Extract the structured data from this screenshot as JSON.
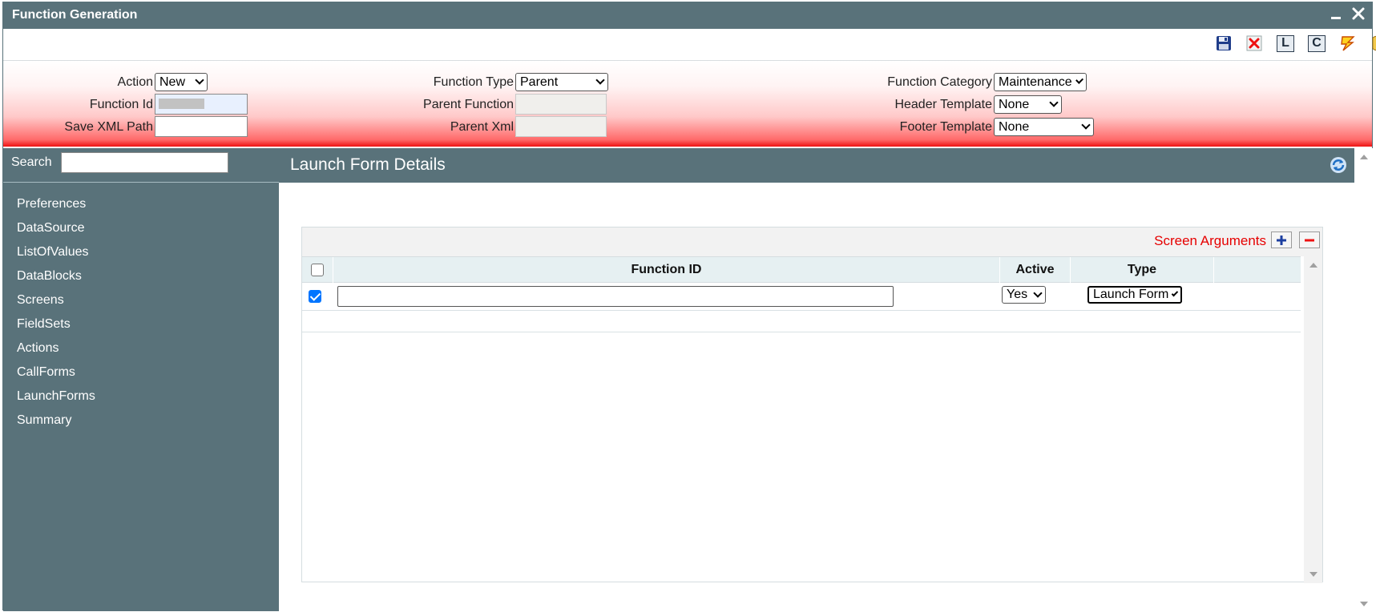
{
  "window": {
    "title": "Function Generation",
    "controls": {
      "minimize_icon": "minimize-icon",
      "close_icon": "close-icon"
    }
  },
  "toolbar": {
    "buttons": [
      {
        "name": "save",
        "icon": "floppy-disk-icon"
      },
      {
        "name": "delete",
        "icon": "red-x-icon"
      },
      {
        "name": "l",
        "label": "L"
      },
      {
        "name": "c",
        "label": "C"
      },
      {
        "name": "generate",
        "icon": "lightning-icon"
      },
      {
        "name": "deploy",
        "icon": "database-icon"
      }
    ]
  },
  "header_form": {
    "action": {
      "label": "Action",
      "value": "New"
    },
    "function_id": {
      "label": "Function Id",
      "value": ""
    },
    "save_xml_path": {
      "label": "Save XML Path",
      "value": ""
    },
    "function_type": {
      "label": "Function Type",
      "value": "Parent"
    },
    "parent_function": {
      "label": "Parent Function",
      "value": ""
    },
    "parent_xml": {
      "label": "Parent Xml",
      "value": ""
    },
    "function_category": {
      "label": "Function Category",
      "value": "Maintenance"
    },
    "header_template": {
      "label": "Header Template",
      "value": "None"
    },
    "footer_template": {
      "label": "Footer Template",
      "value": "None"
    }
  },
  "sidebar": {
    "search_label": "Search",
    "search_value": "",
    "items": [
      {
        "label": "Preferences"
      },
      {
        "label": "DataSource"
      },
      {
        "label": "ListOfValues"
      },
      {
        "label": "DataBlocks"
      },
      {
        "label": "Screens"
      },
      {
        "label": "FieldSets"
      },
      {
        "label": "Actions"
      },
      {
        "label": "CallForms"
      },
      {
        "label": "LaunchForms"
      },
      {
        "label": "Summary"
      }
    ]
  },
  "main": {
    "title": "Launch Form Details",
    "refresh_icon": "refresh-icon",
    "screen_arguments": {
      "title": "Screen Arguments",
      "add_icon": "plus-icon",
      "remove_icon": "minus-icon",
      "columns": [
        "Function ID",
        "Active",
        "Type"
      ],
      "header_checked": false,
      "rows": [
        {
          "checked": true,
          "function_id": "",
          "active": "Yes",
          "type": "Launch Form"
        }
      ]
    }
  },
  "colors": {
    "chrome": "#59727a",
    "accent_red": "#e60000",
    "header_gradient_bottom": "#ee1212",
    "grid_header_bg": "#e6f0f2"
  }
}
